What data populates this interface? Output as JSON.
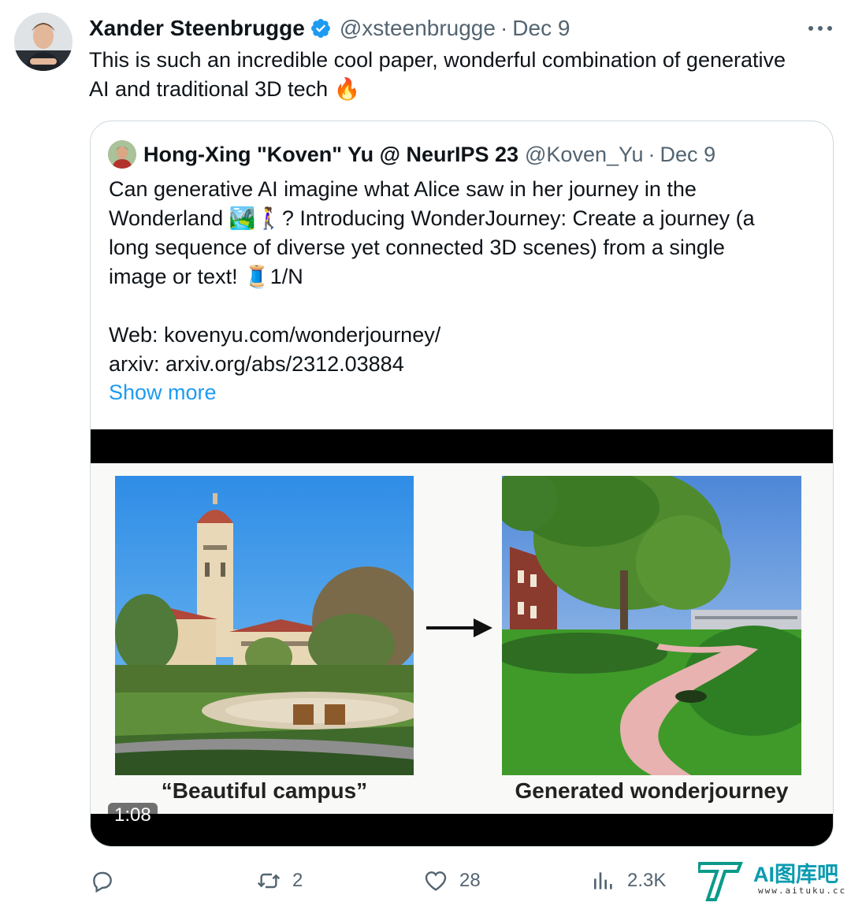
{
  "tweet": {
    "author_name": "Xander Steenbrugge",
    "handle": "@xsteenbrugge",
    "separator": "·",
    "date": "Dec 9",
    "text_lines": [
      "This is such an incredible cool paper, wonderful combination of generative",
      "AI and traditional 3D tech 🔥"
    ]
  },
  "quote": {
    "author_name": "Hong-Xing \"Koven\" Yu @ NeurIPS 23",
    "handle": "@Koven_Yu",
    "separator": "·",
    "date": "Dec 9",
    "text_lines": [
      "Can generative AI imagine what Alice saw in her journey in the",
      "Wonderland 🏞️🚶‍♀️? Introducing WonderJourney: Create a journey (a",
      "long sequence of diverse yet connected 3D scenes) from a single",
      "image or text! 🧵1/N",
      "",
      "Web: kovenyu.com/wonderjourney/",
      "arxiv: arxiv.org/abs/2312.03884"
    ],
    "show_more": "Show more",
    "video": {
      "caption_left": "“Beautiful campus”",
      "caption_right": "Generated wonderjourney",
      "duration": "1:08"
    }
  },
  "actions": {
    "replies": "",
    "retweets": "2",
    "likes": "28",
    "views": "2.3K"
  },
  "watermark": {
    "title": "AI图库吧",
    "url": "www.aituku.cc"
  },
  "colors": {
    "text": "#0f1419",
    "secondary": "#536471",
    "link": "#1d9bf0",
    "border": "#cfd9de",
    "verified": "#1d9bf0"
  }
}
